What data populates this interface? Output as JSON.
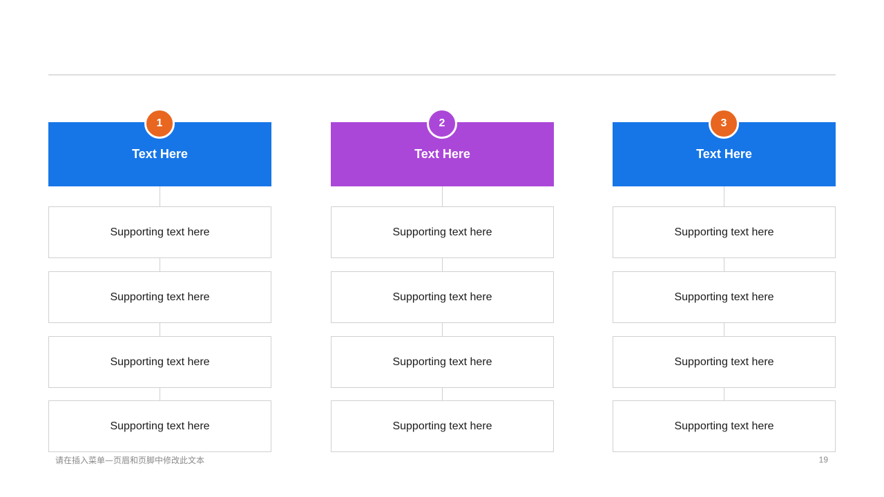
{
  "columns": [
    {
      "number": "1",
      "title": "Text Here",
      "header_color": "#1676E8",
      "badge_color": "#E8661F",
      "items": [
        "Supporting text here",
        "Supporting text here",
        "Supporting text here",
        "Supporting text here"
      ]
    },
    {
      "number": "2",
      "title": "Text Here",
      "header_color": "#AB47D8",
      "badge_color": "#AB47D8",
      "items": [
        "Supporting text here",
        "Supporting text here",
        "Supporting text here",
        "Supporting text here"
      ]
    },
    {
      "number": "3",
      "title": "Text Here",
      "header_color": "#1676E8",
      "badge_color": "#E8661F",
      "items": [
        "Supporting text here",
        "Supporting text here",
        "Supporting text here",
        "Supporting text here"
      ]
    }
  ],
  "footer": {
    "text": "请在插入菜单—页眉和页脚中修改此文本",
    "page_number": "19"
  }
}
